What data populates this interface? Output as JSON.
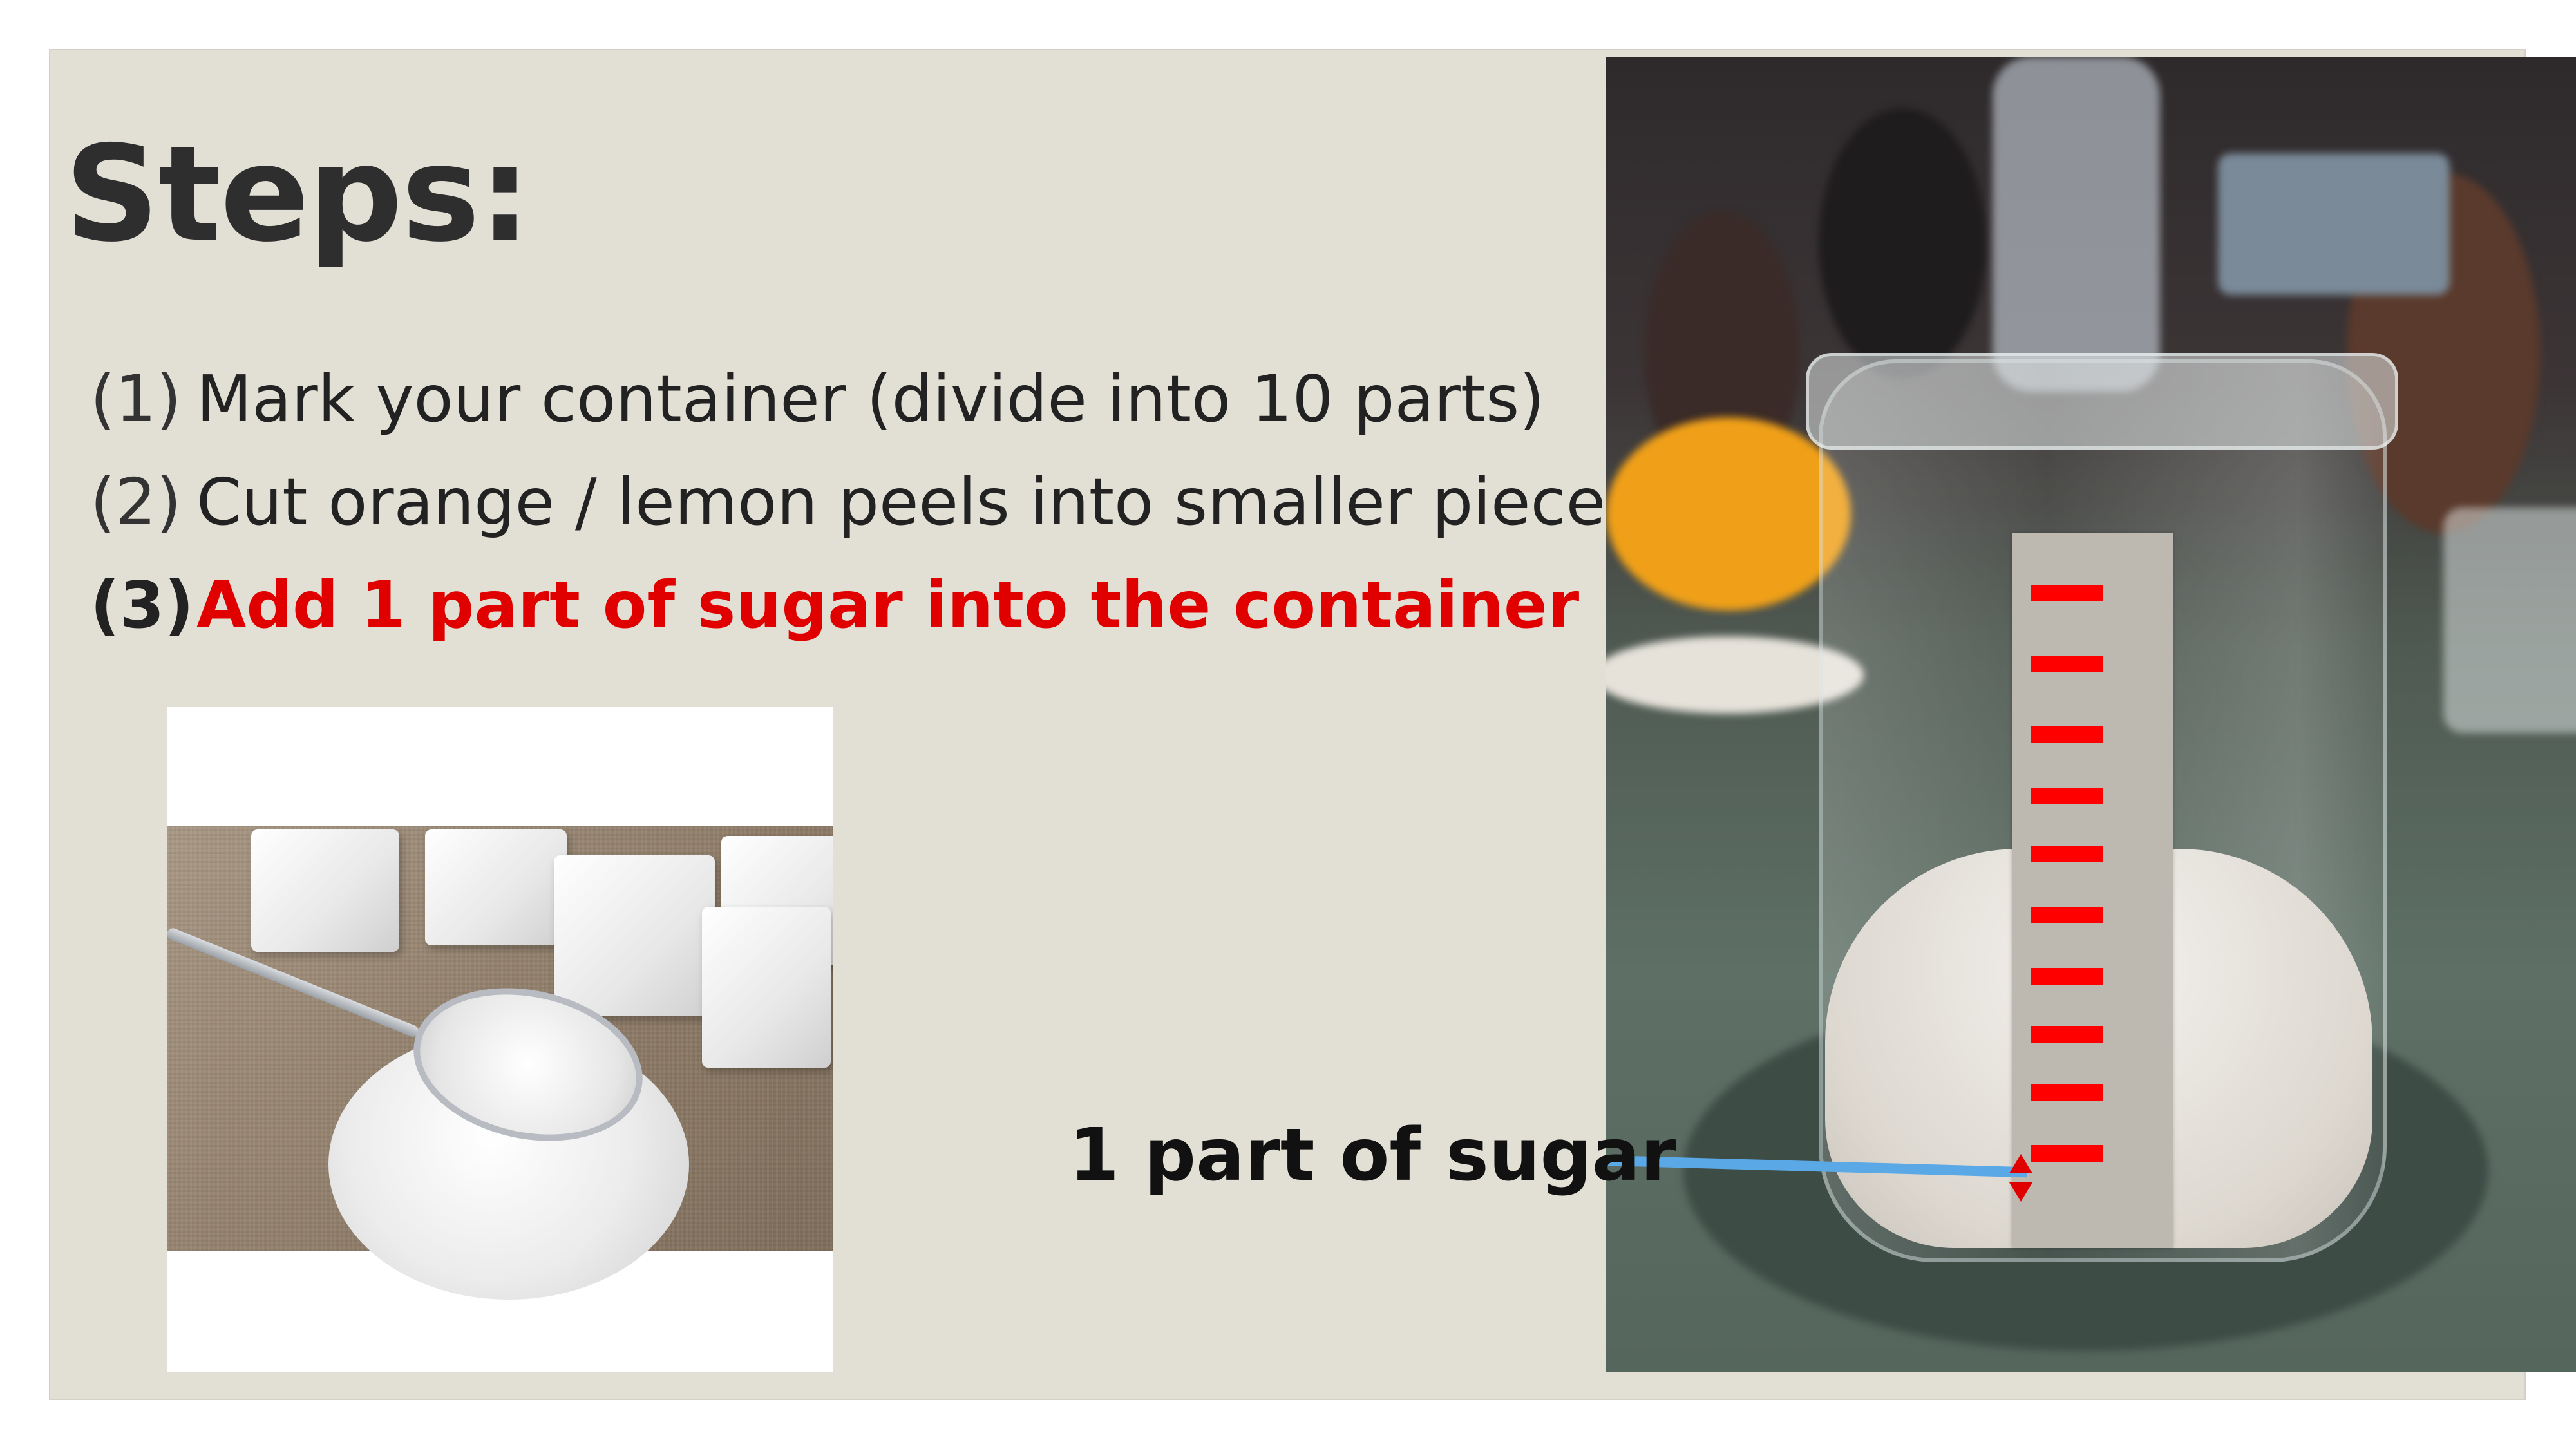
{
  "slide": {
    "title": "Steps:",
    "steps": [
      {
        "number": "(1)",
        "text": "Mark your container (divide into 10 parts)"
      },
      {
        "number": "(2)",
        "text": "Cut orange / lemon peels into smaller pieces"
      },
      {
        "number": "(3)",
        "text": "Add 1 part of sugar into the container"
      }
    ],
    "annotation": "1 part of sugar",
    "highlight_color": "#e00000",
    "marker_color": "#ff0000",
    "pointer_color": "#5aa9e6"
  }
}
